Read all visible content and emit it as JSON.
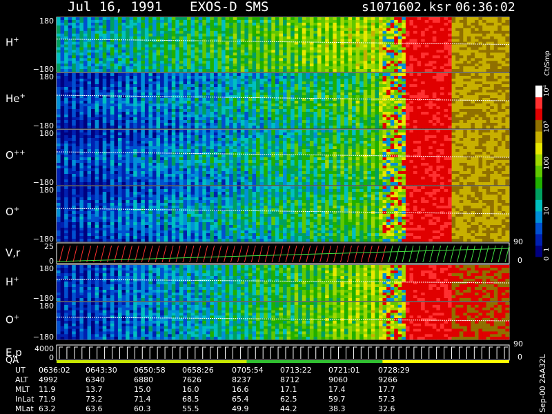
{
  "header": {
    "date": "Jul 16, 1991",
    "instrument": "EXOS-D SMS",
    "file": "s1071602.ksr",
    "time": "06:36:02"
  },
  "chart_data": {
    "type": "heatmap",
    "panels": [
      {
        "label": "H",
        "sup": "+",
        "ymax": "180",
        "ymin": "−180"
      },
      {
        "label": "He",
        "sup": "+",
        "ymax": "180",
        "ymin": "−180"
      },
      {
        "label": "O",
        "sup": "++",
        "ymax": "180",
        "ymin": "−180"
      },
      {
        "label": "O",
        "sup": "+",
        "ymax": "180",
        "ymin": "−180"
      },
      {
        "label": "V,r",
        "sup": "",
        "ymax": "25",
        "ymin": "0",
        "right_top": "90",
        "right_bottom": "0"
      },
      {
        "label": "H",
        "sup": "+",
        "ymax": "180",
        "ymin": "−180"
      },
      {
        "label": "O",
        "sup": "+",
        "ymax": "180",
        "ymin": "−180"
      },
      {
        "label": "E,p",
        "label2": "QA",
        "sup": "",
        "ymax": "4000",
        "ymin": "0",
        "right_top": "90",
        "right_bottom": "0"
      }
    ],
    "colorbar": {
      "unit": "Ct/Smp",
      "ticks": [
        "10",
        "4",
        "10",
        "3",
        "1000",
        "100",
        "10",
        "1",
        "0"
      ],
      "tick_labels": [
        "10⁴",
        "10³",
        "100",
        "10",
        "1",
        "0"
      ]
    },
    "footer_side_label": "Sep-00 2AA32L",
    "time_axis": {
      "rows": [
        {
          "label": "UT",
          "values": [
            "0636:02",
            "0643:30",
            "0650:58",
            "0658:26",
            "0705:54",
            "0713:22",
            "0721:01",
            "0728:29"
          ]
        },
        {
          "label": "ALT",
          "values": [
            "4992",
            "6340",
            "6880",
            "7626",
            "8237",
            "8712",
            "9060",
            "9266"
          ]
        },
        {
          "label": "MLT",
          "values": [
            "11.9",
            "13.7",
            "15.0",
            "16.0",
            "16.6",
            "17.1",
            "17.4",
            "17.7"
          ]
        },
        {
          "label": "InLat",
          "values": [
            "71.9",
            "73.2",
            "71.4",
            "68.5",
            "65.4",
            "62.5",
            "59.7",
            "57.3"
          ]
        },
        {
          "label": "MLat",
          "values": [
            "63.2",
            "63.6",
            "60.3",
            "55.5",
            "49.9",
            "44.2",
            "38.3",
            "32.6"
          ]
        }
      ]
    }
  },
  "colors": {
    "c0": "#000080",
    "c1": "#0020b0",
    "c2": "#0050d0",
    "c3": "#0090d8",
    "c4": "#00c0c0",
    "c5": "#00a060",
    "c6": "#20b000",
    "c7": "#60c800",
    "c8": "#a0d800",
    "c9": "#e8e800",
    "c10": "#c8b000",
    "c11": "#907000",
    "c12": "#e00000",
    "c13": "#ff3030",
    "c14": "#ffffff"
  }
}
